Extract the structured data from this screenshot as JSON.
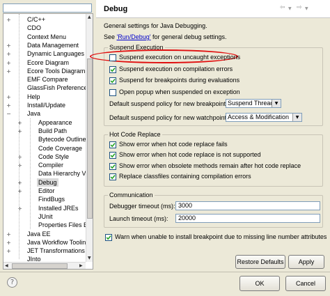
{
  "filter": {
    "value": "",
    "placeholder": ""
  },
  "tree": {
    "items": [
      {
        "label": "C/C++",
        "expander": "+",
        "depth": 0
      },
      {
        "label": "CDO",
        "expander": "",
        "depth": 0
      },
      {
        "label": "Context Menu",
        "expander": "",
        "depth": 0
      },
      {
        "label": "Data Management",
        "expander": "+",
        "depth": 0
      },
      {
        "label": "Dynamic Languages",
        "expander": "+",
        "depth": 0
      },
      {
        "label": "Ecore Diagram",
        "expander": "+",
        "depth": 0
      },
      {
        "label": "Ecore Tools Diagram",
        "expander": "+",
        "depth": 0
      },
      {
        "label": "EMF Compare",
        "expander": "",
        "depth": 0
      },
      {
        "label": "GlassFish Preferences",
        "expander": "",
        "depth": 0
      },
      {
        "label": "Help",
        "expander": "+",
        "depth": 0
      },
      {
        "label": "Install/Update",
        "expander": "+",
        "depth": 0
      },
      {
        "label": "Java",
        "expander": "−",
        "depth": 0
      },
      {
        "label": "Appearance",
        "expander": "+",
        "depth": 1
      },
      {
        "label": "Build Path",
        "expander": "+",
        "depth": 1
      },
      {
        "label": "Bytecode Outline",
        "expander": "",
        "depth": 1
      },
      {
        "label": "Code Coverage",
        "expander": "",
        "depth": 1
      },
      {
        "label": "Code Style",
        "expander": "+",
        "depth": 1
      },
      {
        "label": "Compiler",
        "expander": "+",
        "depth": 1
      },
      {
        "label": "Data Hierarchy Vie",
        "expander": "",
        "depth": 1
      },
      {
        "label": "Debug",
        "expander": "+",
        "depth": 1,
        "selected": true
      },
      {
        "label": "Editor",
        "expander": "+",
        "depth": 1
      },
      {
        "label": "FindBugs",
        "expander": "",
        "depth": 1
      },
      {
        "label": "Installed JREs",
        "expander": "+",
        "depth": 1
      },
      {
        "label": "JUnit",
        "expander": "",
        "depth": 1
      },
      {
        "label": "Properties Files Ed",
        "expander": "",
        "depth": 1
      },
      {
        "label": "Java EE",
        "expander": "+",
        "depth": 0
      },
      {
        "label": "Java Workflow Tooling",
        "expander": "+",
        "depth": 0
      },
      {
        "label": "JET Transformations",
        "expander": "+",
        "depth": 0
      },
      {
        "label": "JInto",
        "expander": "",
        "depth": 0
      }
    ]
  },
  "header": {
    "title": "Debug",
    "back_icon": "back-arrow-icon",
    "back_menu_icon": "chevron-down-icon",
    "forward_icon": "forward-arrow-icon",
    "forward_menu_icon": "chevron-down-icon"
  },
  "content": {
    "description": "General settings for Java Debugging.",
    "see_prefix": "See ",
    "see_link": "'Run/Debug'",
    "see_suffix": " for general debug settings.",
    "suspend_group": {
      "title": "Suspend Execution",
      "options": [
        {
          "label": "Suspend execution on uncaught exceptions",
          "checked": false
        },
        {
          "label": "Suspend execution on compilation errors",
          "checked": true
        },
        {
          "label": "Suspend for breakpoints during evaluations",
          "checked": true
        },
        {
          "label": "Open popup when suspended on exception",
          "checked": false
        }
      ],
      "breakpoint_policy_label": "Default suspend policy for new breakpoints:",
      "breakpoint_policy_value": "Suspend Thread",
      "watchpoint_policy_label": "Default suspend policy for new watchpoints:",
      "watchpoint_policy_value": "Access & Modification"
    },
    "hcr_group": {
      "title": "Hot Code Replace",
      "options": [
        {
          "label": "Show error when hot code replace fails",
          "checked": true
        },
        {
          "label": "Show error when hot code replace is not supported",
          "checked": true
        },
        {
          "label": "Show error when obsolete methods remain after hot code replace",
          "checked": true
        },
        {
          "label": "Replace classfiles containing compilation errors",
          "checked": true
        }
      ]
    },
    "comm_group": {
      "title": "Communication",
      "debugger_timeout_label": "Debugger timeout (ms):",
      "debugger_timeout_value": "3000",
      "launch_timeout_label": "Launch timeout (ms):",
      "launch_timeout_value": "20000"
    },
    "warn_option": {
      "label": "Warn when unable to install breakpoint due to missing line number attributes",
      "checked": true
    },
    "restore_defaults_label": "Restore Defaults",
    "apply_label": "Apply"
  },
  "footer": {
    "help_icon": "help-icon",
    "ok_label": "OK",
    "cancel_label": "Cancel"
  },
  "annotation": {
    "color": "#e01010",
    "shape": "ellipse around first suspend option"
  }
}
